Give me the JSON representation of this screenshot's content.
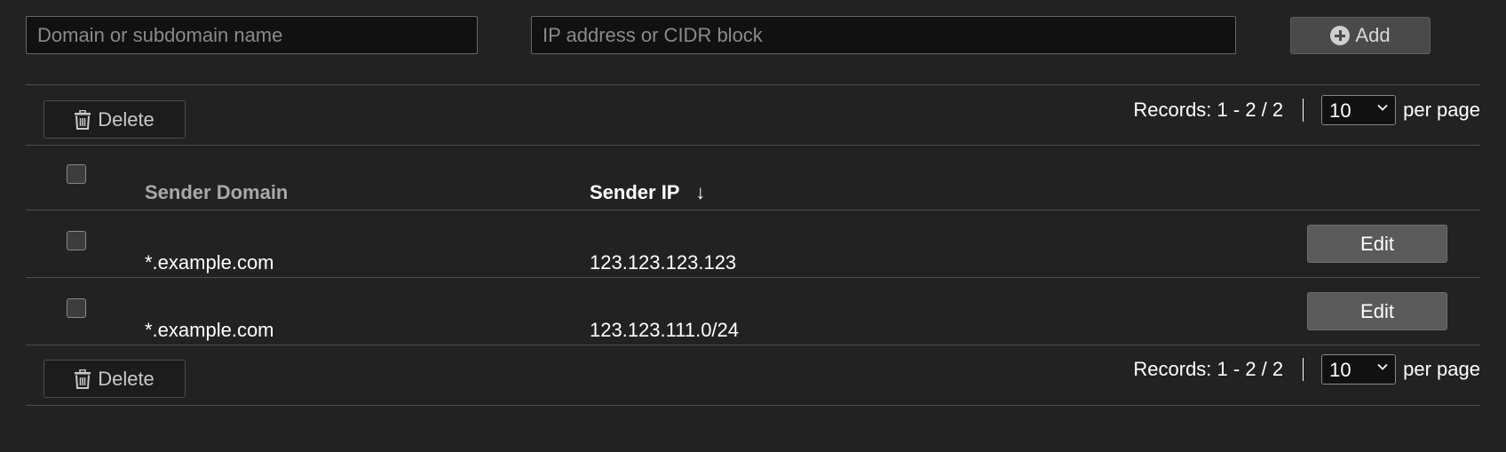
{
  "form": {
    "domain_placeholder": "Domain or subdomain name",
    "ip_placeholder": "IP address or CIDR block",
    "add_label": "Add"
  },
  "toolbar": {
    "delete_label": "Delete",
    "records_text": "Records: 1 - 2 / 2",
    "per_page_value": "10",
    "per_page_label": "per page"
  },
  "table": {
    "columns": {
      "domain": "Sender Domain",
      "ip": "Sender IP",
      "sort_indicator": "↓"
    },
    "rows": [
      {
        "domain": "*.example.com",
        "ip": "123.123.123.123",
        "action": "Edit"
      },
      {
        "domain": "*.example.com",
        "ip": "123.123.111.0/24",
        "action": "Edit"
      }
    ]
  },
  "icons": {
    "add": "plus-circle-icon",
    "delete": "trash-icon",
    "sort": "arrow-down-icon",
    "dropdown": "chevron-down-icon"
  }
}
